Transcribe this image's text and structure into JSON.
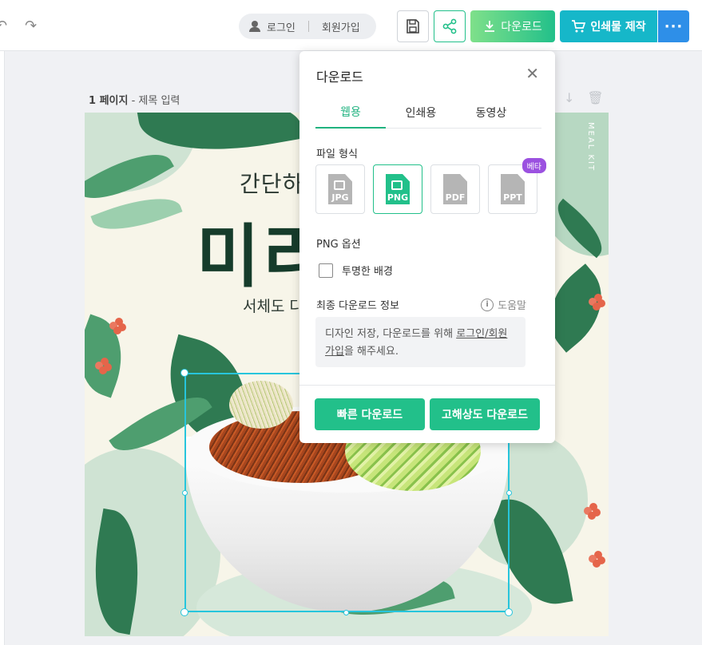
{
  "toolbar": {
    "undo_icon": "undo-icon",
    "redo_icon": "redo-icon",
    "login_label": "로그인",
    "signup_label": "회원가입",
    "download_label": "다운로드",
    "print_label": "인쇄물 제작",
    "more_label": "···",
    "accent_green": "#22c08a",
    "accent_teal": "#16b7c9",
    "accent_blue": "#2e8fe8"
  },
  "page": {
    "number_label": "1 페이지",
    "separator": " - ",
    "title_placeholder": "제목 입력"
  },
  "canvas": {
    "headline_top": "간단하게",
    "headline_big": "미리",
    "headline_sub": "서체도 다",
    "side_text": "MEAL KIT"
  },
  "download_panel": {
    "title": "다운로드",
    "close_icon": "close-icon",
    "tabs": [
      {
        "label": "웹용",
        "active": true
      },
      {
        "label": "인쇄용",
        "active": false
      },
      {
        "label": "동영상",
        "active": false
      }
    ],
    "file_format_label": "파일 형식",
    "formats": [
      {
        "label": "JPG",
        "selected": false
      },
      {
        "label": "PNG",
        "selected": true
      },
      {
        "label": "PDF",
        "selected": false
      },
      {
        "label": "PPT",
        "selected": false,
        "badge": "베타"
      }
    ],
    "png_options_label": "PNG 옵션",
    "transparent_bg_label": "투명한 배경",
    "transparent_bg_checked": false,
    "final_info_label": "최종 다운로드 정보",
    "help_label": "도움말",
    "info_text_prefix": "디자인 저장, 다운로드를 위해 ",
    "info_link": "로그인/회원가입",
    "info_text_suffix": "을 해주세요.",
    "fast_download_label": "빠른 다운로드",
    "hires_download_label": "고해상도 다운로드"
  }
}
